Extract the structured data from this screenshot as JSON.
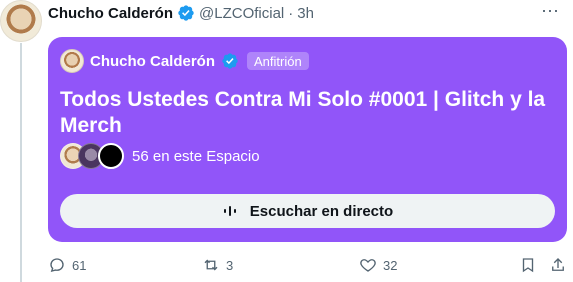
{
  "tweet": {
    "author_name": "Chucho Calderón",
    "handle": "@LZCOficial",
    "separator": "·",
    "time": "3h",
    "more_icon": "⋯"
  },
  "space": {
    "host_name": "Chucho Calderón",
    "host_badge": "Anfitrión",
    "title": "Todos Ustedes Contra Mi Solo #0001 | Glitch y la Merch",
    "listeners_text": "56 en este Espacio",
    "listen_button": "Escuchar en directo",
    "accent_color": "#9155f9"
  },
  "actions": {
    "reply_count": "61",
    "retweet_count": "3",
    "like_count": "32"
  },
  "icons": {
    "verified": "verified-icon",
    "reply": "reply-icon",
    "retweet": "retweet-icon",
    "like": "heart-icon",
    "bookmark": "bookmark-icon",
    "share": "share-icon",
    "audio": "audio-wave-icon"
  }
}
